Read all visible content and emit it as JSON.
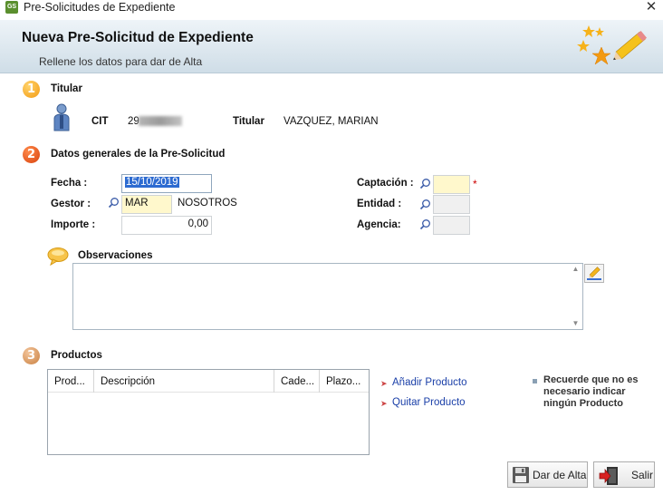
{
  "window": {
    "title": "Pre-Solicitudes de Expediente",
    "app_icon_text": "GS",
    "close": "✕"
  },
  "header": {
    "title": "Nueva Pre-Solicitud de Expediente",
    "subtitle": "Rellene los datos para dar de Alta"
  },
  "sections": {
    "titular": {
      "number": "1",
      "label": "Titular"
    },
    "datos": {
      "number": "2",
      "label": "Datos generales de la Pre-Solicitud"
    },
    "productos": {
      "number": "3",
      "label": "Productos"
    }
  },
  "titular": {
    "cit_label": "CIT",
    "cit_value": "29",
    "titular_label": "Titular",
    "titular_value": "VAZQUEZ, MARIAN"
  },
  "form": {
    "fecha_label": "Fecha :",
    "fecha_value": "15/10/2019",
    "gestor_label": "Gestor :",
    "gestor_code": "MAR",
    "gestor_name": "NOSOTROS",
    "importe_label": "Importe :",
    "importe_value": "0,00",
    "captacion_label": "Captación :",
    "captacion_value": "",
    "required_mark": "*",
    "entidad_label": "Entidad :",
    "entidad_value": "",
    "agencia_label": "Agencia:",
    "agencia_value": ""
  },
  "observaciones": {
    "label": "Observaciones",
    "value": ""
  },
  "productos": {
    "columns": [
      "Prod...",
      "Descripción",
      "Cade...",
      "Plazo..."
    ],
    "rows": [],
    "add_link": "Añadir Producto",
    "remove_link": "Quitar Producto",
    "note": "Recuerde que no es necesario indicar ningún Producto"
  },
  "buttons": {
    "alta": "Dar de Alta",
    "salir": "Salir"
  },
  "colors": {
    "accent": "#2d6bd1",
    "link": "#1a3fa8",
    "required": "#cc0000",
    "input_yellow": "#fff8cc"
  }
}
